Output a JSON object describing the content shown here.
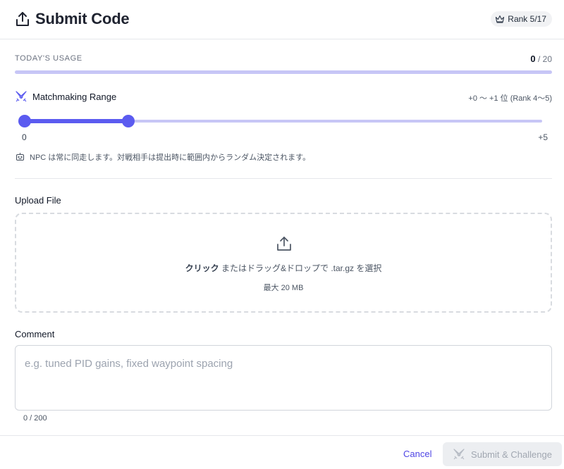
{
  "header": {
    "title": "Submit Code",
    "rank_badge": "Rank 5/17"
  },
  "usage": {
    "label": "TODAY'S USAGE",
    "current": "0",
    "separator": "/",
    "max": "20",
    "fraction": 0
  },
  "matchmaking": {
    "label": "Matchmaking Range",
    "range_text": "+0 〜 +1 位 (Rank 4〜5)",
    "slider": {
      "min_label": "0",
      "max_label": "+5",
      "min": 0,
      "max": 5,
      "low": 0,
      "high": 1
    },
    "note": "NPC は常に同走します。対戦相手は提出時に範囲内からランダム決定されます。"
  },
  "upload": {
    "label": "Upload File",
    "prompt_bold": "クリック",
    "prompt_rest": " またはドラッグ&ドロップで .tar.gz を選択",
    "max_size": "最大 20 MB"
  },
  "comment": {
    "label": "Comment",
    "placeholder": "e.g. tuned PID gains, fixed waypoint spacing",
    "count": "0 / 200"
  },
  "footer": {
    "cancel": "Cancel",
    "submit": "Submit & Challenge"
  },
  "colors": {
    "accent": "#5b5bf0",
    "accent_light": "#c7c6f6",
    "link": "#4f46e5",
    "disabled_bg": "#eceef1"
  }
}
